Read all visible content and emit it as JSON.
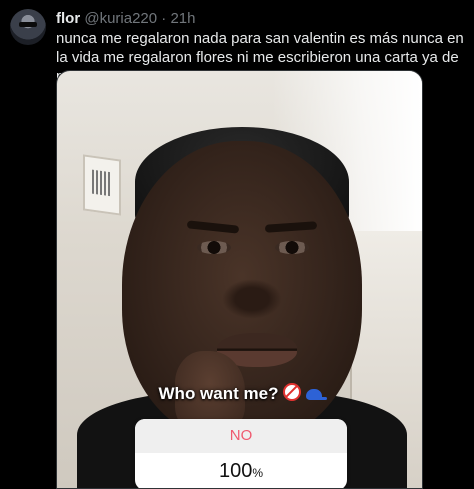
{
  "tweet": {
    "author_name": "flor",
    "handle": "@kuria220",
    "separator": "·",
    "time": "21h",
    "text": "nunca me regalaron nada para san valentin es más nunca en la vida me regalaron flores ni me escribieron una carta ya de por sí"
  },
  "media": {
    "caption": "Who want me?",
    "caption_icons": [
      "prohibited-icon",
      "blue-cap-icon"
    ],
    "poll": {
      "option_label": "NO",
      "result_value": "100",
      "result_unit": "%"
    }
  }
}
